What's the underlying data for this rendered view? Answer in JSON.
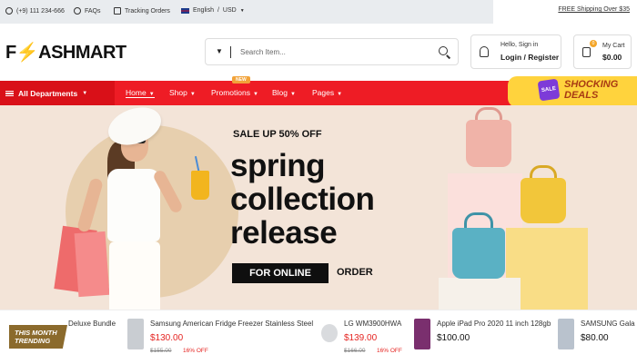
{
  "topbar": {
    "phone": "(+9) 111 234-666",
    "faqs": "FAQs",
    "tracking": "Tracking Orders",
    "language": "English",
    "currency": "USD",
    "free_shipping": "FREE Shipping Over $35"
  },
  "header": {
    "logo_letter": "F",
    "logo_rest": "ASHMART",
    "search_placeholder": "Search Item...",
    "account_greeting": "Hello, Sign in",
    "login": "Login / Register",
    "cart_label": "My Cart",
    "cart_amount": "$0.00",
    "cart_count": "0"
  },
  "nav": {
    "departments": "All Departments",
    "items": [
      {
        "label": "Home"
      },
      {
        "label": "Shop"
      },
      {
        "label": "Promotions"
      },
      {
        "label": "Blog"
      },
      {
        "label": "Pages"
      }
    ],
    "new_badge": "NEW",
    "deals_sale": "SALE",
    "deals_line1": "SHOCKING",
    "deals_line2": "DEALS"
  },
  "hero": {
    "sale": "SALE UP 50% OFF",
    "line1": "spring",
    "line2": "collection",
    "line3": "release",
    "cta": "FOR ONLINE",
    "cta_suffix": "ORDER"
  },
  "trending": {
    "badge_line1": "THIS MONTH",
    "badge_line2": "TRENDING",
    "products": [
      {
        "name": "Deluxe Bundle"
      },
      {
        "name": "Samsung American Fridge Freezer Stainless Steel",
        "price": "$130.00",
        "old": "$155.00",
        "off": "16% OFF"
      },
      {
        "name": "LG WM3900HWA",
        "price": "$139.00",
        "old": "$166.00",
        "off": "16% OFF"
      },
      {
        "name": "Apple iPad Pro 2020 11 inch 128gb",
        "price": "$100.00"
      },
      {
        "name": "SAMSUNG Gala",
        "price": "$80.00"
      }
    ]
  }
}
